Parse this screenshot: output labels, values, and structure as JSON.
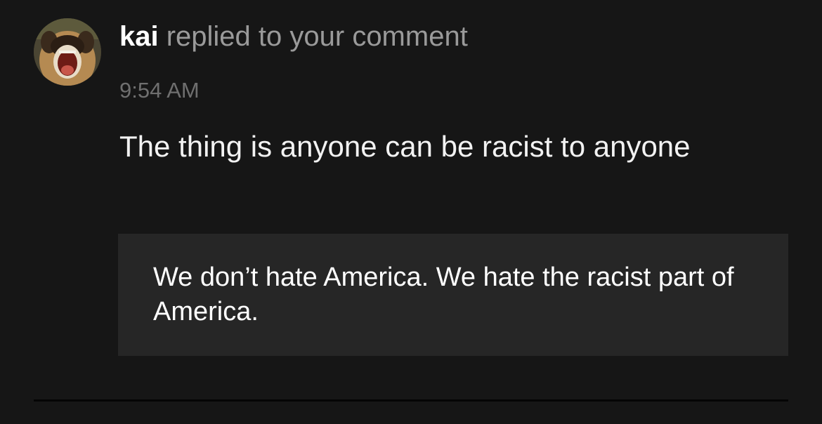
{
  "notification": {
    "username": "kai",
    "action_text": " replied to your comment",
    "timestamp": "9:54 AM",
    "reply_text": "The thing is anyone can be racist to anyone",
    "quoted_comment": "We don’t hate America. We hate the racist part of America."
  },
  "colors": {
    "background": "#161616",
    "quote_background": "#262626",
    "username": "#ffffff",
    "action_text": "#9a9a9a",
    "timestamp": "#6f6f6f",
    "reply_text": "#f2f2f2"
  },
  "icons": {
    "avatar": "dog-photo-avatar"
  }
}
